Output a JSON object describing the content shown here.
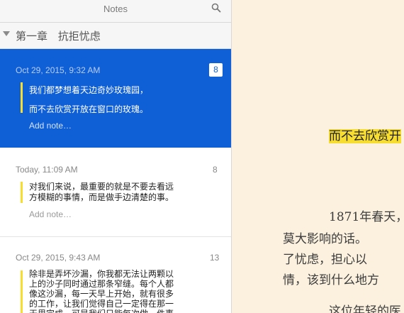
{
  "sidebar": {
    "title": "Notes",
    "chapter": "第一章 抗拒忧虑",
    "notes": [
      {
        "date": "Oct 29, 2015, 9:32 AM",
        "page": "8",
        "text": "我们都梦想着天边奇妙玫瑰园，\n而不去欣赏开放在窗口的玫瑰。",
        "add_note": "Add note…"
      },
      {
        "date": "Today, 11:09 AM",
        "page": "8",
        "text": "对我们来说，最重要的就是不要去看远\n方模糊的事情，而是做手边清楚的事。",
        "add_note": "Add note…"
      },
      {
        "date": "Oct 29, 2015, 9:43 AM",
        "page": "13",
        "text": "除非是弄坏沙漏，你我都无法让两颗以\n上的沙子同时通过那条窄缝。每个人都\n像这沙漏，每一天早上开始，就有很多\n的工作，让我们觉得自己一定得在那一\n天里完成，可是我们只能每次做一件事"
      }
    ]
  },
  "book": {
    "highlight": "而不去欣赏开",
    "lines": [
      "1871年春天，",
      "莫大影响的话。",
      "了忧虑，担心以",
      "情，该到什么地方",
      "这位年轻的医"
    ]
  },
  "colors": {
    "selection": "#0f5fd7",
    "highlight": "#f7dd2f",
    "page_bg": "#fbf1de"
  }
}
